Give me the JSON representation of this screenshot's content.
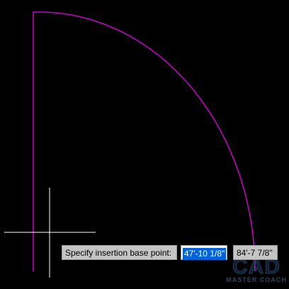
{
  "command_prompt": {
    "label": "Specify insertion base point:",
    "x_value": "47'-10 1/8\"",
    "y_value": "84'-7 7/8\""
  },
  "watermark": {
    "logo_main": "CAD",
    "logo_sub": "MASTER COACH"
  },
  "colors": {
    "background": "#000000",
    "geometry": "#cc00cc",
    "crosshair": "#ffffff",
    "selection": "#0063d8"
  }
}
